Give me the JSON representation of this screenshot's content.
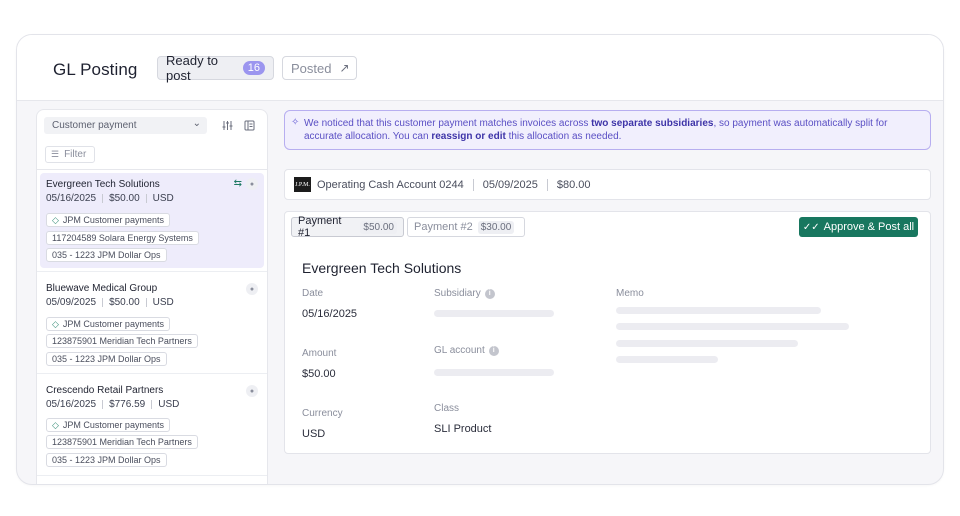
{
  "header": {
    "title": "GL Posting",
    "tabs": [
      {
        "label": "Ready to post",
        "count": "16"
      },
      {
        "label": "Posted",
        "icon": "arrow-up-right-icon"
      }
    ]
  },
  "sidebar": {
    "select_value": "Customer payment",
    "filter_label": "Filter",
    "items": [
      {
        "name": "Evergreen Tech Solutions",
        "date": "05/16/2025",
        "amount": "$50.00",
        "currency": "USD",
        "chips": [
          "JPM Customer payments",
          "117204589 Solara Energy Systems",
          "035 - 1223 JPM Dollar Ops"
        ]
      },
      {
        "name": "Bluewave Medical Group",
        "date": "05/09/2025",
        "amount": "$50.00",
        "currency": "USD",
        "chips": [
          "JPM Customer payments",
          "123875901 Meridian Tech Partners",
          "035 - 1223 JPM Dollar Ops"
        ]
      },
      {
        "name": "Crescendo Retail Partners",
        "date": "05/16/2025",
        "amount": "$776.59",
        "currency": "USD",
        "chips": [
          "JPM Customer payments",
          "123875901 Meridian Tech Partners",
          "035 - 1223 JPM Dollar Ops"
        ]
      }
    ]
  },
  "notice": {
    "part1": "We noticed that this customer payment matches invoices across ",
    "bold1": "two separate subsidiaries",
    "part2": ", so payment was automatically split for accurate allocation. You can ",
    "bold2": "reassign or edit",
    "part3": " this allocation as needed."
  },
  "account": {
    "logo": "J.P.M.",
    "name": "Operating Cash Account 0244",
    "date": "05/09/2025",
    "amount": "$80.00"
  },
  "payments": [
    {
      "label": "Payment #1",
      "amount": "$50.00"
    },
    {
      "label": "Payment #2",
      "amount": "$30.00"
    }
  ],
  "approve_label": "Approve & Post all",
  "detail": {
    "customer": "Evergreen Tech Solutions",
    "date_label": "Date",
    "date_value": "05/16/2025",
    "amount_label": "Amount",
    "amount_value": "$50.00",
    "currency_label": "Currency",
    "currency_value": "USD",
    "subsidiary_label": "Subsidiary",
    "gl_label": "GL account",
    "class_label": "Class",
    "class_value": "SLI Product",
    "memo_label": "Memo"
  },
  "colors": {
    "accent": "#9b95ef",
    "approve": "#18775f",
    "notice_border": "#b7aef0"
  }
}
